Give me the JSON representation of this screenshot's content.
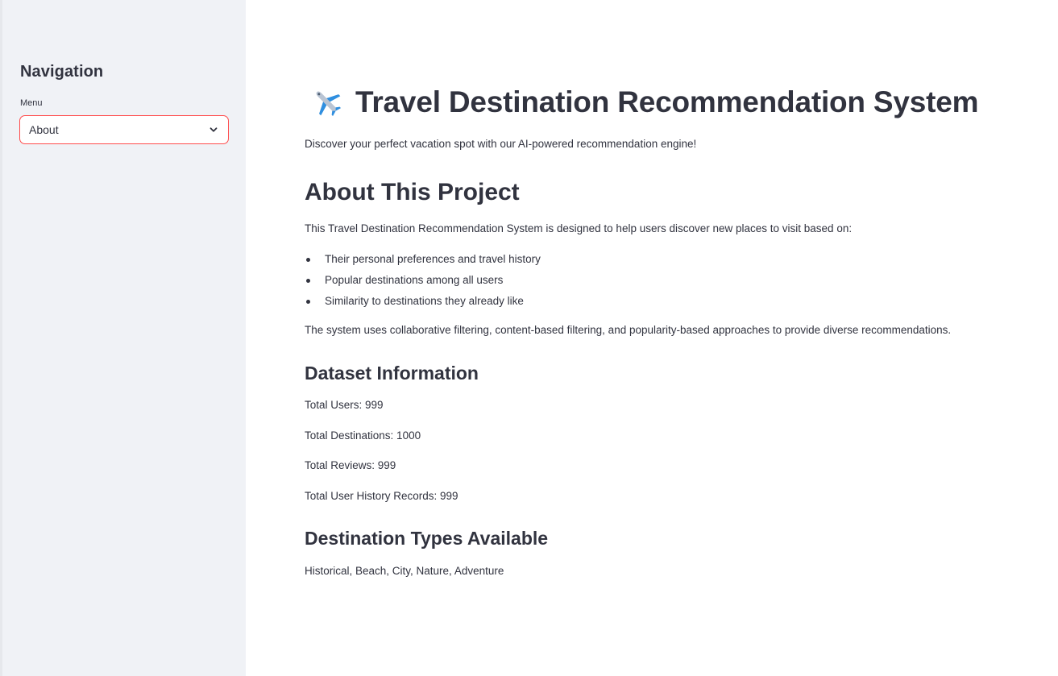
{
  "sidebar": {
    "title": "Navigation",
    "menu_label": "Menu",
    "menu_selected": "About"
  },
  "main": {
    "title": "Travel Destination Recommendation System",
    "title_icon": "airplane-icon",
    "subtitle": "Discover your perfect vacation spot with our AI-powered recommendation engine!",
    "about_heading": "About This Project",
    "about_intro": "This Travel Destination Recommendation System is designed to help users discover new places to visit based on:",
    "about_points": [
      "Their personal preferences and travel history",
      "Popular destinations among all users",
      "Similarity to destinations they already like"
    ],
    "about_methods": "The system uses collaborative filtering, content-based filtering, and popularity-based approaches to provide diverse recommendations.",
    "dataset_heading": "Dataset Information",
    "dataset_stats": [
      "Total Users: 999",
      "Total Destinations: 1000",
      "Total Reviews: 999",
      "Total User History Records: 999"
    ],
    "types_heading": "Destination Types Available",
    "types_list": "Historical, Beach, City, Nature, Adventure"
  },
  "colors": {
    "accent_border": "#ff4b4b",
    "sidebar_bg": "#f0f2f6",
    "text": "#31333f"
  }
}
